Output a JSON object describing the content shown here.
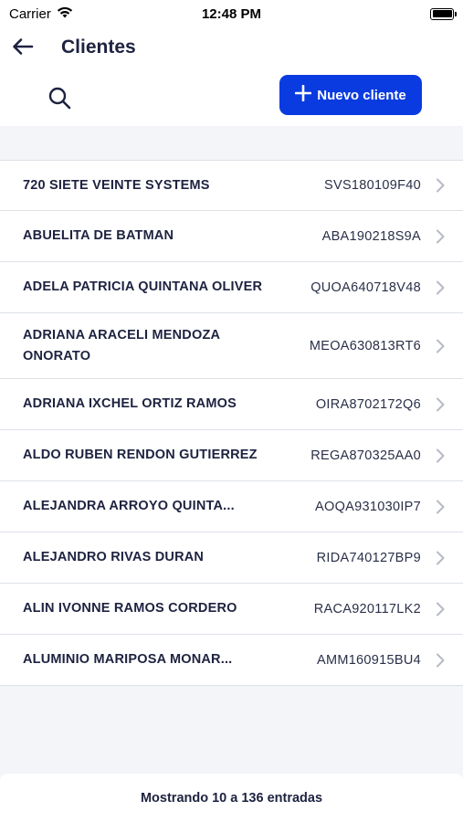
{
  "status_bar": {
    "carrier": "Carrier",
    "time": "12:48 PM",
    "icons": [
      "wifi-icon",
      "battery-icon"
    ]
  },
  "header": {
    "title": "Clientes",
    "back_icon": "arrow-left-icon",
    "search_icon": "search-icon",
    "new_button": {
      "icon": "plus-icon",
      "label": "Nuevo cliente"
    }
  },
  "clients": [
    {
      "name": "720 SIETE VEINTE SYSTEMS",
      "rfc": "SVS180109F40"
    },
    {
      "name": "ABUELITA DE BATMAN",
      "rfc": "ABA190218S9A"
    },
    {
      "name": "ADELA PATRICIA QUINTANA OLIVER",
      "rfc": "QUOA640718V48"
    },
    {
      "name": "ADRIANA ARACELI MENDOZA ONORATO",
      "rfc": "MEOA630813RT6"
    },
    {
      "name": "ADRIANA IXCHEL ORTIZ RAMOS",
      "rfc": "OIRA8702172Q6"
    },
    {
      "name": "ALDO RUBEN RENDON GUTIERREZ",
      "rfc": "REGA870325AA0"
    },
    {
      "name": "ALEJANDRA ARROYO QUINTA...",
      "rfc": "AOQA931030IP7"
    },
    {
      "name": "ALEJANDRO RIVAS DURAN",
      "rfc": "RIDA740127BP9"
    },
    {
      "name": "ALIN IVONNE RAMOS CORDERO",
      "rfc": "RACA920117LK2"
    },
    {
      "name": "ALUMINIO MARIPOSA MONAR...",
      "rfc": "AMM160915BU4"
    }
  ],
  "footer": {
    "text": "Mostrando 10 a 136 entradas"
  },
  "colors": {
    "accent": "#0a3be0",
    "text": "#1d2240",
    "background": "#f3f5f8"
  }
}
